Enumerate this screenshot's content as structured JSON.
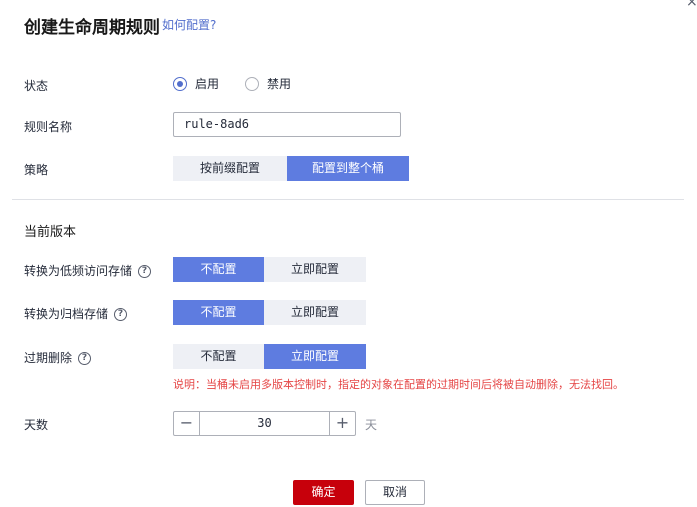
{
  "dialog": {
    "title": "创建生命周期规则",
    "help_link": "如何配置?",
    "close_icon": "×"
  },
  "status": {
    "label": "状态",
    "options": [
      {
        "label": "启用",
        "checked": true
      },
      {
        "label": "禁用",
        "checked": false
      }
    ]
  },
  "rule_name": {
    "label": "规则名称",
    "value": "rule-8ad6"
  },
  "policy": {
    "label": "策略",
    "options": [
      "按前缀配置",
      "配置到整个桶"
    ],
    "selected": "配置到整个桶"
  },
  "current_version": {
    "title": "当前版本",
    "transition_infrequent": {
      "label": "转换为低频访问存储",
      "options": [
        "不配置",
        "立即配置"
      ],
      "selected": "不配置"
    },
    "transition_archive": {
      "label": "转换为归档存储",
      "options": [
        "不配置",
        "立即配置"
      ],
      "selected": "不配置"
    },
    "expiration": {
      "label": "过期删除",
      "options": [
        "不配置",
        "立即配置"
      ],
      "selected": "立即配置",
      "note_prefix": "说明：",
      "note": "当桶未启用多版本控制时，指定的对象在配置的过期时间后将被自动删除，无法找回。"
    },
    "days": {
      "label": "天数",
      "value": "30",
      "unit": "天",
      "minus": "−",
      "plus": "+"
    }
  },
  "footer": {
    "ok_label": "确定",
    "cancel_label": "取消"
  },
  "colors": {
    "accent": "#5e7ce0",
    "primary_button": "#c7000b",
    "note_text": "#e54545"
  },
  "help_icon_glyph": "?"
}
